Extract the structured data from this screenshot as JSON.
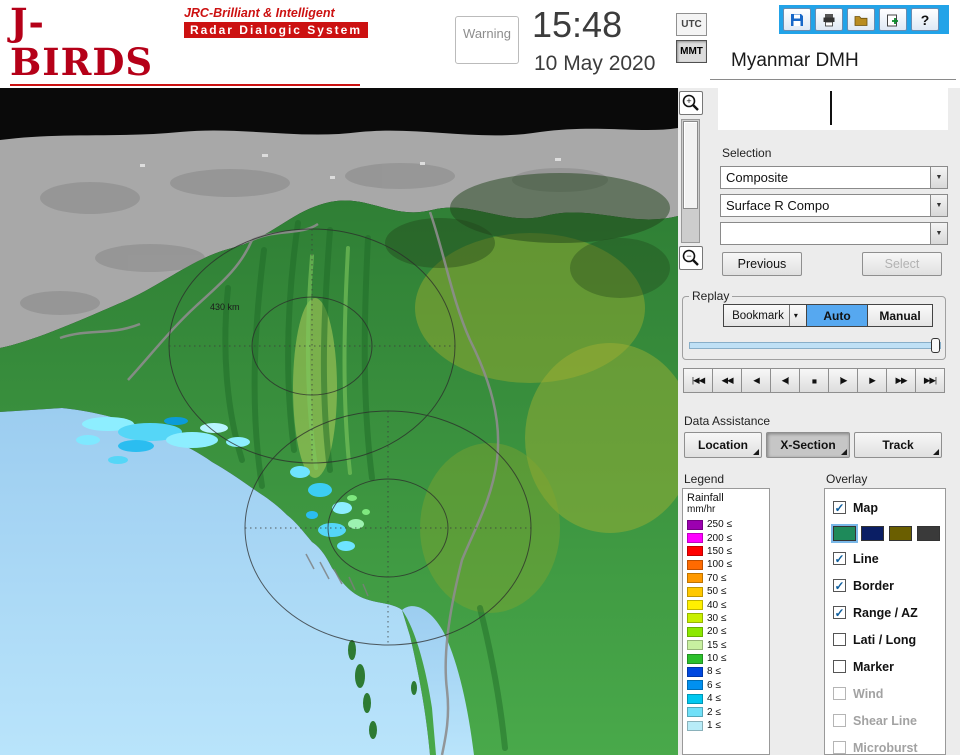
{
  "header": {
    "logo": {
      "title": "J-BIRDS",
      "tagline_top": "JRC-Brilliant & Intelligent",
      "tagline_bottom": "Radar  Dialogic  System"
    },
    "warning_button": "Warning",
    "time": "15:48",
    "date": "10 May 2020",
    "timezone_utc": "UTC",
    "timezone_mmt": "MMT",
    "timezone_selected": "MMT",
    "help_button": "?",
    "station": "Myanmar DMH"
  },
  "map": {
    "range_label": "430 km"
  },
  "zoom": {
    "in": "+",
    "out": "−"
  },
  "selection": {
    "label": "Selection",
    "dropdowns": [
      {
        "value": "Composite"
      },
      {
        "value": "Surface R Compo"
      },
      {
        "value": ""
      }
    ],
    "previous_button": "Previous",
    "select_button": "Select"
  },
  "replay": {
    "label": "Replay",
    "bookmark_button": "Bookmark",
    "auto_button": "Auto",
    "manual_button": "Manual",
    "selected_mode": "Auto",
    "playback_buttons": [
      "|◀◀",
      "◀◀",
      "◀",
      "◀|",
      "■",
      "|▶",
      "▶",
      "▶▶",
      "▶▶|"
    ]
  },
  "data_assistance": {
    "label": "Data Assistance",
    "buttons": [
      {
        "label": "Location",
        "enabled": true
      },
      {
        "label": "X-Section",
        "enabled": false
      },
      {
        "label": "Track",
        "enabled": true
      }
    ]
  },
  "legend": {
    "label": "Legend",
    "unit_line1": "Rainfall",
    "unit_line2": "mm/hr",
    "suffix": "≤",
    "entries": [
      {
        "value": "250",
        "color": "#9c00b0"
      },
      {
        "value": "200",
        "color": "#ff00ff"
      },
      {
        "value": "150",
        "color": "#ff0000"
      },
      {
        "value": "100",
        "color": "#ff6a00"
      },
      {
        "value": "70",
        "color": "#ff9a00"
      },
      {
        "value": "50",
        "color": "#ffc800"
      },
      {
        "value": "40",
        "color": "#fff000"
      },
      {
        "value": "30",
        "color": "#c8f000"
      },
      {
        "value": "20",
        "color": "#8ce800"
      },
      {
        "value": "15",
        "color": "#c8f0a0"
      },
      {
        "value": "10",
        "color": "#2cc02c"
      },
      {
        "value": "8",
        "color": "#0048e0"
      },
      {
        "value": "6",
        "color": "#0090f0"
      },
      {
        "value": "4",
        "color": "#00c8f0"
      },
      {
        "value": "2",
        "color": "#70e0f8"
      },
      {
        "value": "1",
        "color": "#b8ecf8"
      }
    ]
  },
  "overlay": {
    "label": "Overlay",
    "items": [
      {
        "label": "Map",
        "checked": true,
        "enabled": true
      },
      {
        "label": "Line",
        "checked": true,
        "enabled": true
      },
      {
        "label": "Border",
        "checked": true,
        "enabled": true
      },
      {
        "label": "Range / AZ",
        "checked": true,
        "enabled": true
      },
      {
        "label": "Lati / Long",
        "checked": false,
        "enabled": true
      },
      {
        "label": "Marker",
        "checked": false,
        "enabled": true
      },
      {
        "label": "Wind",
        "checked": false,
        "enabled": false
      },
      {
        "label": "Shear Line",
        "checked": false,
        "enabled": false
      },
      {
        "label": "Microburst",
        "checked": false,
        "enabled": false
      }
    ],
    "map_styles": [
      "#1e8a5a",
      "#0a1e64",
      "#6a5e00",
      "#3a3a3a"
    ],
    "selected_map_style": 0
  },
  "colors": {
    "accent_blue": "#22a3e8",
    "auto_selected": "#56a8f0",
    "logo_red": "#c00018"
  }
}
